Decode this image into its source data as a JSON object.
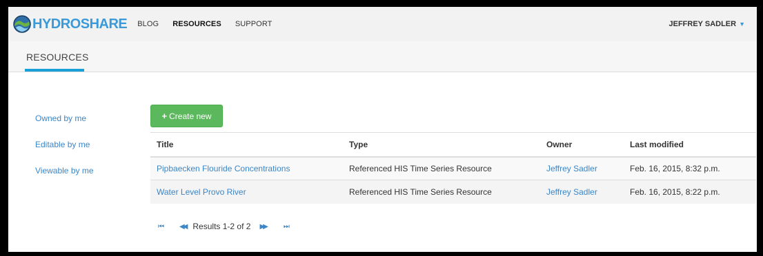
{
  "brand": {
    "part1": "HYDRO",
    "part2": "SHARE"
  },
  "nav": {
    "blog": "BLOG",
    "resources": "RESOURCES",
    "support": "SUPPORT",
    "user": "JEFFREY SADLER",
    "caret": "▼"
  },
  "subheader": {
    "title": "RESOURCES"
  },
  "sidebar": {
    "items": [
      {
        "label": "Owned by me"
      },
      {
        "label": "Editable by me"
      },
      {
        "label": "Viewable by me"
      }
    ]
  },
  "create_button": {
    "icon": "+",
    "label": "Create new"
  },
  "table": {
    "headers": [
      "Title",
      "Type",
      "Owner",
      "Last modified"
    ],
    "rows": [
      {
        "title": "Pipbaecken Flouride Concentrations",
        "type": "Referenced HIS Time Series Resource",
        "owner": "Jeffrey Sadler",
        "modified": "Feb. 16, 2015, 8:32 p.m."
      },
      {
        "title": "Water Level Provo River",
        "type": "Referenced HIS Time Series Resource",
        "owner": "Jeffrey Sadler",
        "modified": "Feb. 16, 2015, 8:22 p.m."
      }
    ]
  },
  "pager": {
    "first_icon": "⏮",
    "prev_icon": "◀◀",
    "label": "Results 1-2 of 2",
    "next_icon": "▶▶",
    "last_icon": "⏭"
  },
  "colors": {
    "accent": "#1aa0d8",
    "link": "#3a86c8",
    "button_green": "#5cb85c"
  }
}
